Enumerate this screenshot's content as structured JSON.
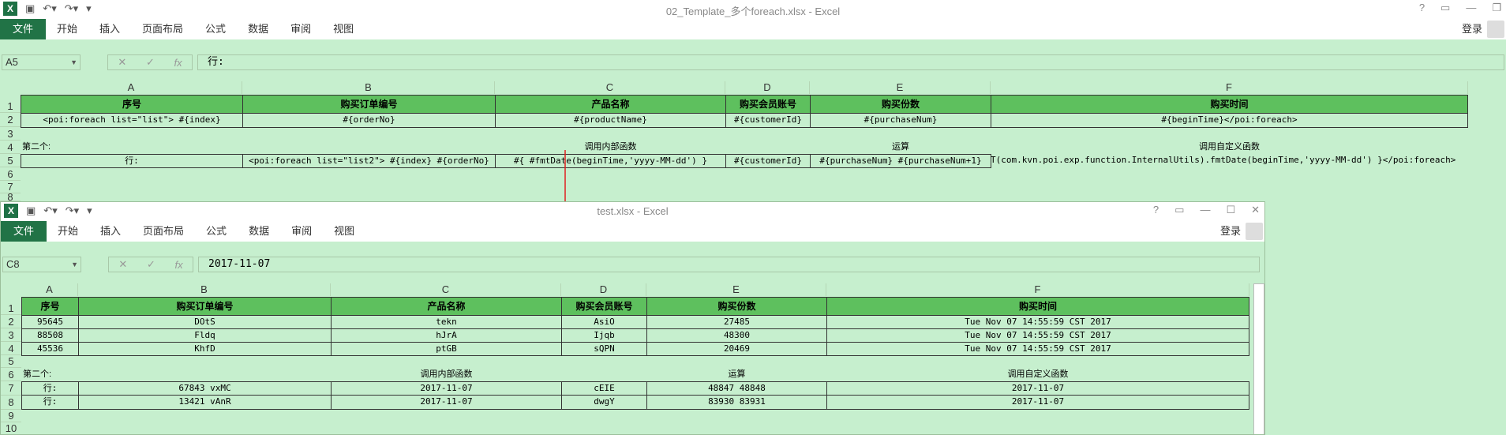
{
  "win1": {
    "title": "02_Template_多个foreach.xlsx - Excel",
    "tabs": [
      "开始",
      "插入",
      "页面布局",
      "公式",
      "数据",
      "审阅",
      "视图"
    ],
    "file_tab": "文件",
    "login": "登录",
    "name_box": "A5",
    "formula": "行:",
    "col_headers": [
      "A",
      "B",
      "C",
      "D",
      "E",
      "F"
    ],
    "row_headers": [
      "1",
      "2",
      "3",
      "4",
      "5",
      "6",
      "7",
      "8"
    ],
    "header_row": [
      "序号",
      "购买订单编号",
      "产品名称",
      "购买会员账号",
      "购买份数",
      "购买时间"
    ],
    "row2": [
      "<poi:foreach list=\"list\"> #{index}",
      "#{orderNo}",
      "#{productName}",
      "#{customerId}",
      "#{purchaseNum}",
      "#{beginTime}</poi:foreach>"
    ],
    "row4": [
      "第二个:",
      "调用内部函数",
      "运算",
      "调用自定义函数"
    ],
    "row5": [
      "行:",
      "<poi:foreach list=\"list2\"> #{index} #{orderNo}",
      "#{ #fmtDate(beginTime,'yyyy-MM-dd') }",
      "#{customerId}",
      "#{purchaseNum} #{purchaseNum+1}",
      "T(com.kvn.poi.exp.function.InternalUtils).fmtDate(beginTime,'yyyy-MM-dd') }</poi:foreach>"
    ]
  },
  "win2": {
    "title": "test.xlsx - Excel",
    "tabs": [
      "开始",
      "插入",
      "页面布局",
      "公式",
      "数据",
      "审阅",
      "视图"
    ],
    "file_tab": "文件",
    "login": "登录",
    "name_box": "C8",
    "formula": "2017-11-07",
    "col_headers": [
      "A",
      "B",
      "C",
      "D",
      "E",
      "F"
    ],
    "row_headers": [
      "1",
      "2",
      "3",
      "4",
      "5",
      "6",
      "7",
      "8",
      "9",
      "10"
    ],
    "header_row": [
      "序号",
      "购买订单编号",
      "产品名称",
      "购买会员账号",
      "购买份数",
      "购买时间"
    ],
    "data_rows": [
      [
        "95645",
        "DOtS",
        "tekn",
        "AsiO",
        "27485",
        "Tue Nov 07 14:55:59 CST 2017"
      ],
      [
        "88508",
        "Fldq",
        "hJrA",
        "Ijqb",
        "48300",
        "Tue Nov 07 14:55:59 CST 2017"
      ],
      [
        "45536",
        "KhfD",
        "ptGB",
        "sQPN",
        "20469",
        "Tue Nov 07 14:55:59 CST 2017"
      ]
    ],
    "row6": [
      "第二个:",
      "调用内部函数",
      "运算",
      "调用自定义函数"
    ],
    "row7": [
      "行:",
      "67843 vxMC",
      "2017-11-07",
      "cEIE",
      "48847 48848",
      "2017-11-07"
    ],
    "row8": [
      "行:",
      "13421 vAnR",
      "2017-11-07",
      "dwgY",
      "83930 83931",
      "2017-11-07"
    ]
  },
  "colors": {
    "excel_green": "#217346",
    "cell_bg": "#c6efce",
    "header_bg": "#5ec05e",
    "arrow": "#e02020"
  }
}
